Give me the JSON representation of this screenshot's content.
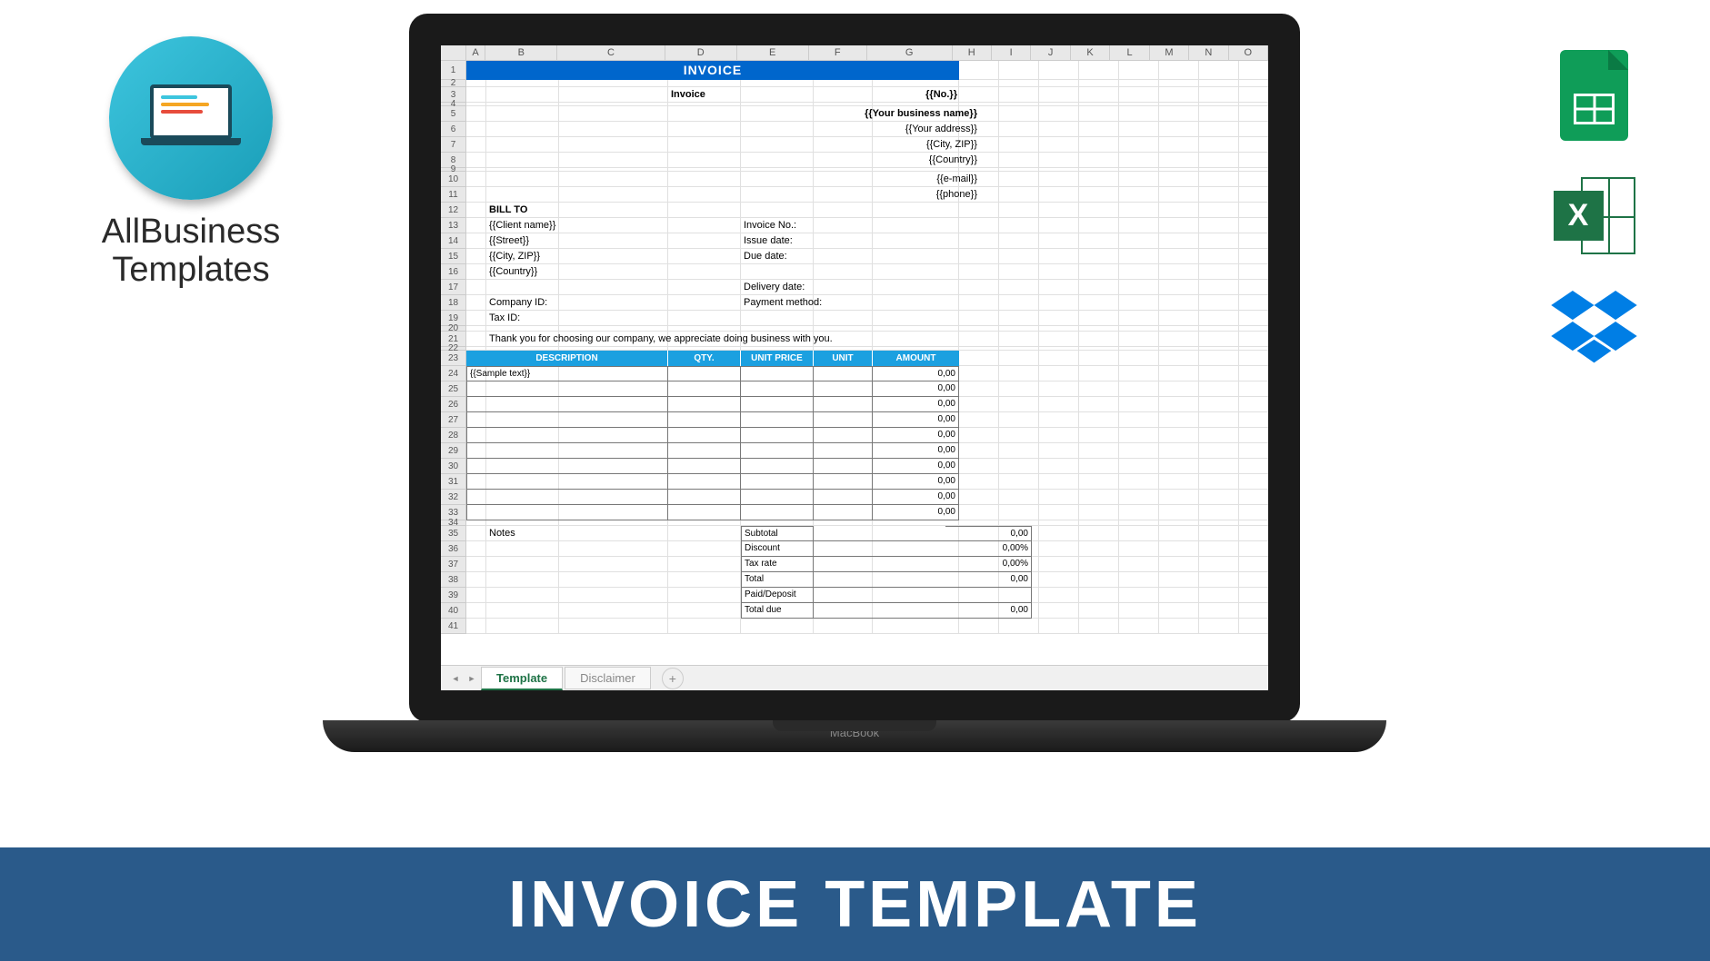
{
  "logo": {
    "line1": "AllBusiness",
    "line2": "Templates"
  },
  "footer": "INVOICE TEMPLATE",
  "laptop_brand": "MacBook",
  "columns": [
    "A",
    "B",
    "C",
    "D",
    "E",
    "F",
    "G",
    "H",
    "I",
    "J",
    "K",
    "L",
    "M",
    "N",
    "O"
  ],
  "rows": [
    1,
    2,
    3,
    4,
    5,
    6,
    7,
    8,
    9,
    10,
    11,
    12,
    13,
    14,
    15,
    16,
    17,
    18,
    19,
    20,
    21,
    22,
    23,
    24,
    25,
    26,
    27,
    28,
    29,
    30,
    31,
    32,
    33,
    34,
    35,
    36,
    37,
    38,
    39,
    40,
    41
  ],
  "tabs": {
    "active": "Template",
    "inactive": "Disclaimer"
  },
  "invoice": {
    "banner": "INVOICE",
    "header_label": "Invoice",
    "header_no": "{{No.}}",
    "business": {
      "name": "{{Your business name}}",
      "address": "{{Your address}}",
      "cityzip": "{{City, ZIP}}",
      "country": "{{Country}}",
      "email": "{{e-mail}}",
      "phone": "{{phone}}"
    },
    "billto_label": "BILL TO",
    "billto": {
      "client": "{{Client name}}",
      "street": "{{Street}}",
      "cityzip": "{{City, ZIP}}",
      "country": "{{Country}}"
    },
    "meta": {
      "invoice_no": "Invoice No.:",
      "issue_date": "Issue date:",
      "due_date": "Due date:",
      "delivery_date": "Delivery date:",
      "payment_method": "Payment method:"
    },
    "company_id": "Company ID:",
    "tax_id": "Tax ID:",
    "thanks": "Thank you for choosing our company, we appreciate doing business with you.",
    "table_headers": {
      "desc": "DESCRIPTION",
      "qty": "QTY.",
      "unit_price": "UNIT PRICE",
      "unit": "UNIT",
      "amount": "AMOUNT"
    },
    "sample_text": "{{Sample text}}",
    "amount_zero": "0,00",
    "notes": "Notes",
    "summary": {
      "subtotal": "Subtotal",
      "discount": "Discount",
      "tax_rate": "Tax rate",
      "total": "Total",
      "paid": "Paid/Deposit",
      "total_due": "Total due",
      "pct_zero": "0,00%"
    }
  }
}
